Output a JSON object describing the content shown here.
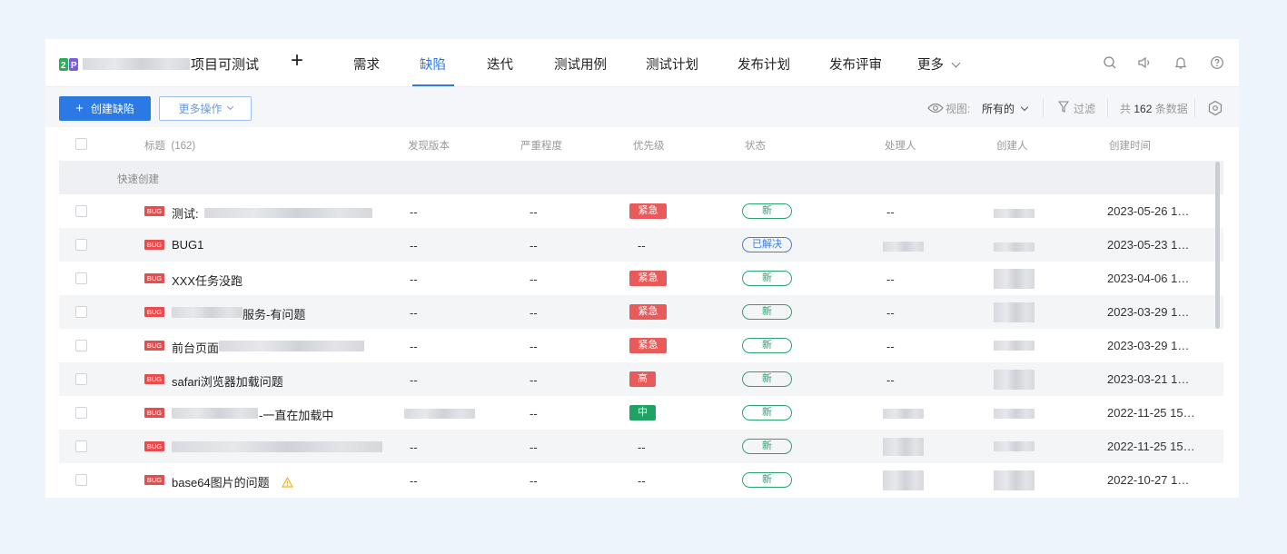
{
  "nav": {
    "project_name": "项目可测试",
    "plus_label": "+",
    "items": [
      "需求",
      "缺陷",
      "迭代",
      "测试用例",
      "测试计划",
      "发布计划",
      "发布评审",
      "更多"
    ]
  },
  "toolbar": {
    "create_label": "创建缺陷",
    "create_icon": "+",
    "more_ops_label": "更多操作",
    "view_label": "视图:",
    "view_value": "所有的",
    "filter_label": "过滤",
    "count_prefix": "共",
    "count_value": "162",
    "count_suffix": "条数据"
  },
  "table": {
    "headers": {
      "title": "标题",
      "title_count": "(162)",
      "found_version": "发现版本",
      "severity": "严重程度",
      "priority": "优先级",
      "status": "状态",
      "handler": "处理人",
      "creator": "创建人",
      "created_at": "创建时间"
    },
    "quick_create": "快速创建",
    "bug_tag": "BUG",
    "rows": [
      {
        "title": "测试:",
        "found_version": "--",
        "severity": "--",
        "priority": "紧急",
        "status": "新",
        "handler": "--",
        "created_at": "2023-05-26 1…"
      },
      {
        "title": "BUG1",
        "found_version": "--",
        "severity": "--",
        "priority": "--",
        "status": "已解决",
        "handler": "",
        "created_at": "2023-05-23 1…"
      },
      {
        "title": "XXX任务没跑",
        "found_version": "--",
        "severity": "--",
        "priority": "紧急",
        "status": "新",
        "handler": "--",
        "created_at": "2023-04-06 1…"
      },
      {
        "title": "服务-有问题",
        "found_version": "--",
        "severity": "--",
        "priority": "紧急",
        "status": "新",
        "handler": "--",
        "created_at": "2023-03-29 1…"
      },
      {
        "title": "前台页面",
        "found_version": "--",
        "severity": "--",
        "priority": "紧急",
        "status": "新",
        "handler": "--",
        "created_at": "2023-03-29 1…"
      },
      {
        "title": "safari浏览器加载问题",
        "found_version": "--",
        "severity": "--",
        "priority": "高",
        "status": "新",
        "handler": "--",
        "created_at": "2023-03-21 1…"
      },
      {
        "title": "-一直在加载中",
        "found_version": "",
        "severity": "--",
        "priority": "中",
        "status": "新",
        "handler": "",
        "created_at": "2022-11-25 15…"
      },
      {
        "title": "",
        "found_version": "--",
        "severity": "--",
        "priority": "--",
        "status": "新",
        "handler": "",
        "created_at": "2022-11-25 15…"
      },
      {
        "title": "base64图片的问题",
        "found_version": "--",
        "severity": "--",
        "priority": "--",
        "status": "新",
        "handler": "",
        "created_at": "2022-10-27 1…"
      }
    ]
  },
  "colors": {
    "accent": "#2b7ae4",
    "bug_tag": "#e84c4c",
    "priority_urgent": "#e95a5a",
    "priority_medium": "#20a264",
    "status_new": "#2ba470",
    "status_resolved": "#3d7fe0"
  },
  "icons": [
    "app-logo-icon",
    "search-icon",
    "speaker-icon",
    "bell-icon",
    "help-icon",
    "eye-icon",
    "filter-icon",
    "settings-icon",
    "warning-icon",
    "chevron-down-icon"
  ]
}
